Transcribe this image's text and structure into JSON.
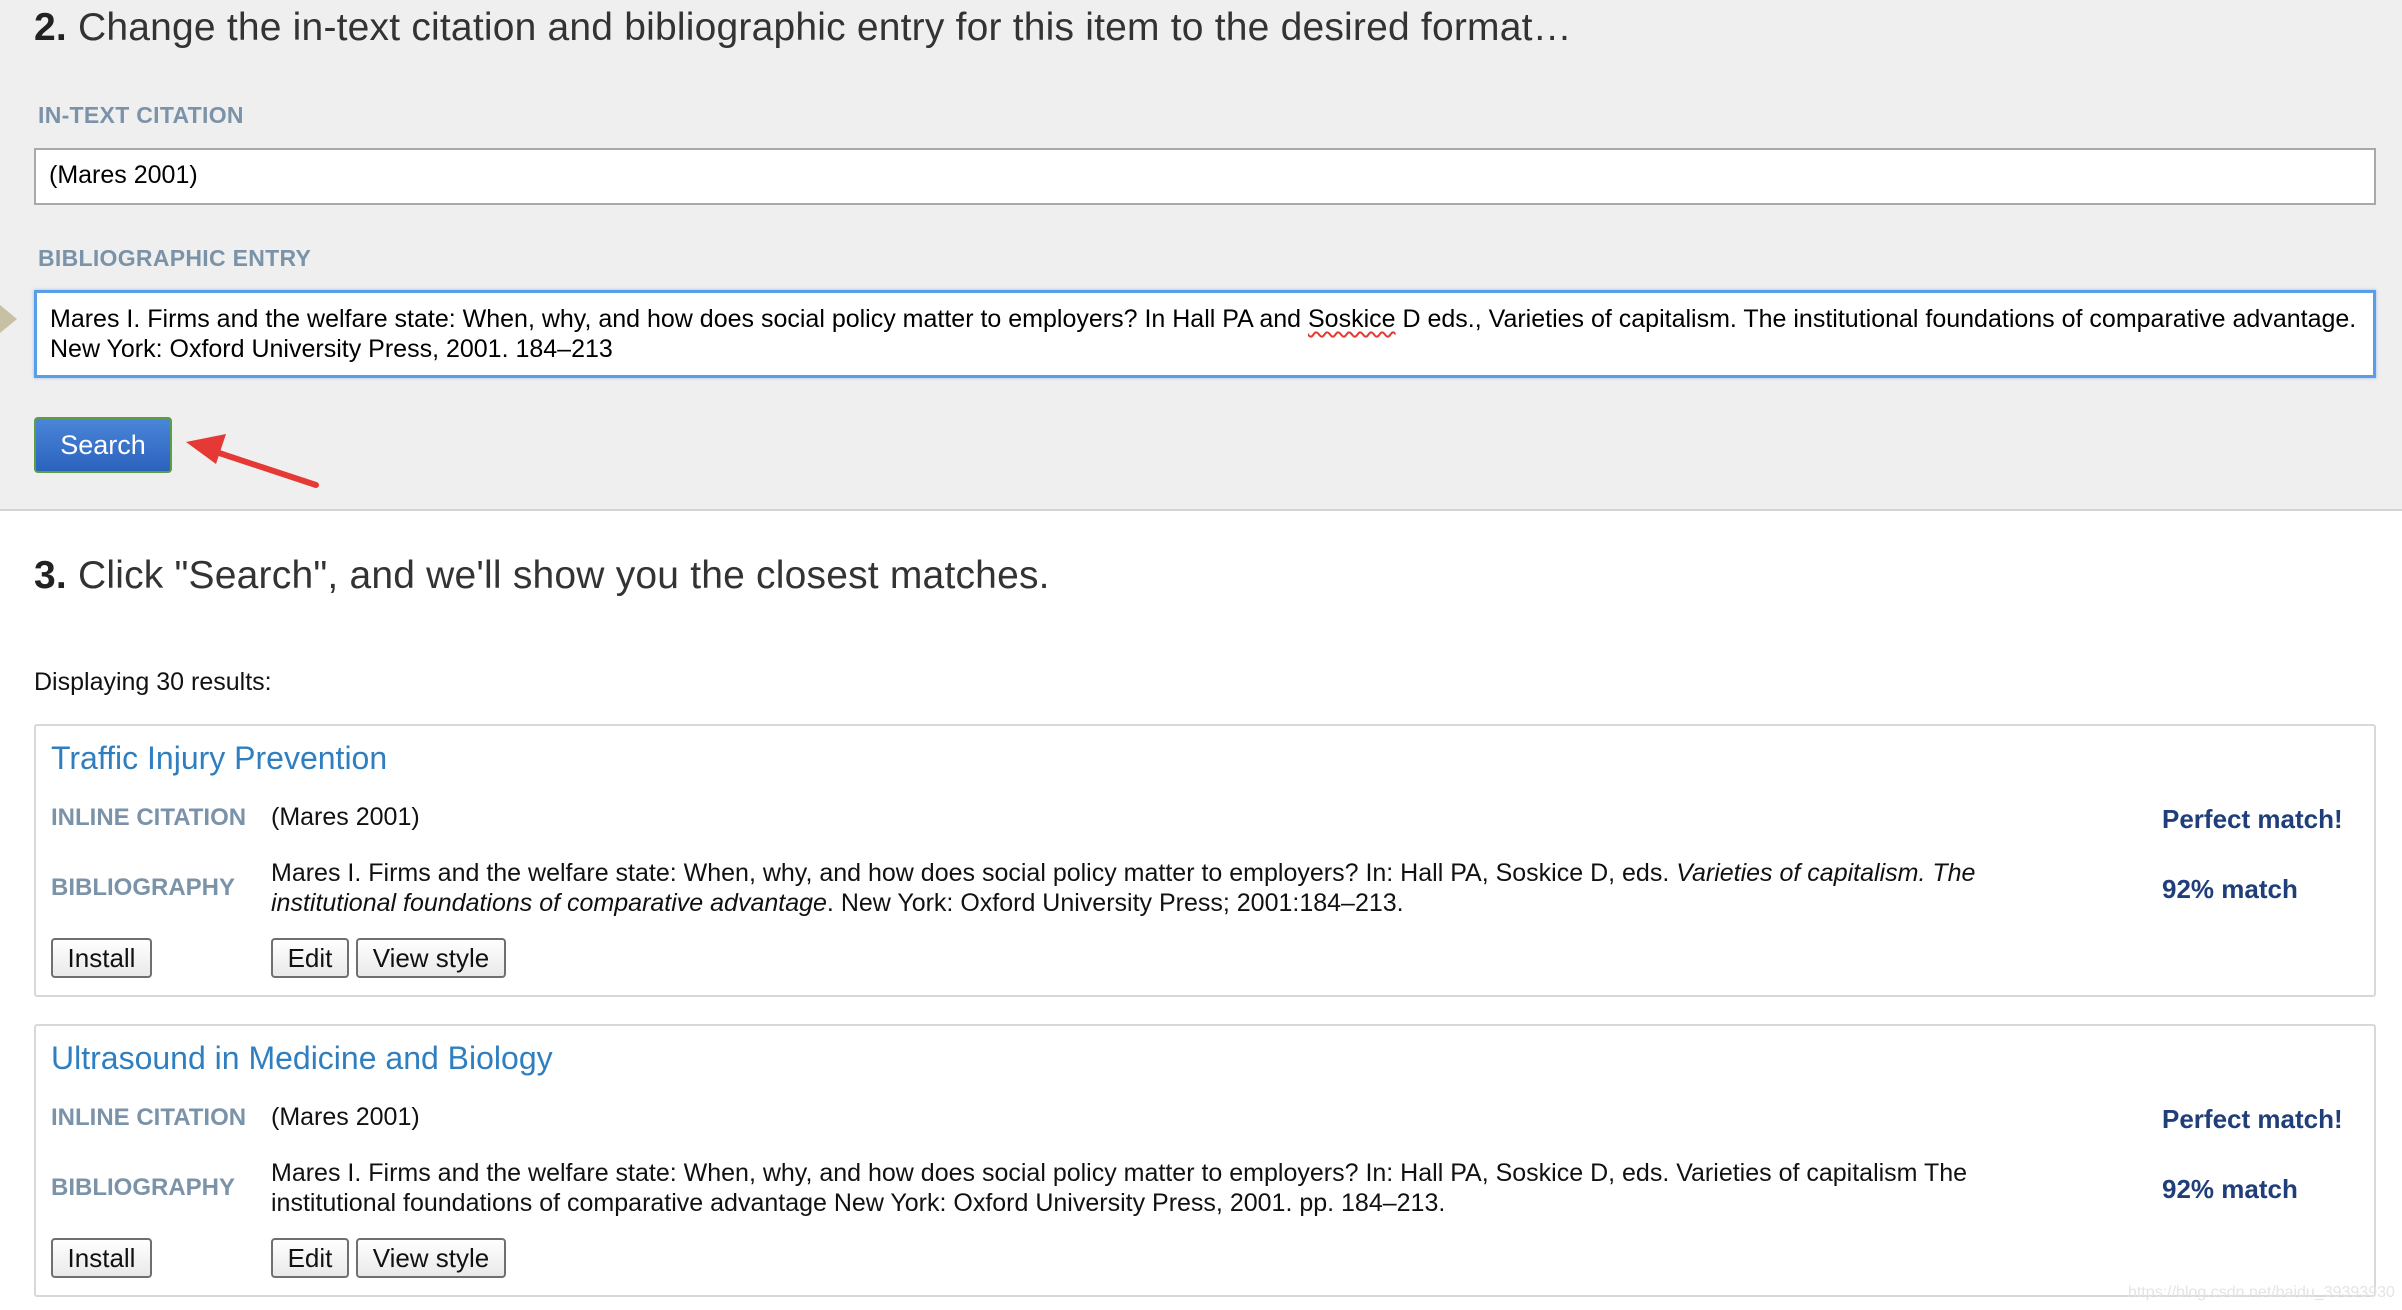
{
  "step2": {
    "number": "2.",
    "heading": "Change the in-text citation and bibliographic entry for this item to the desired format…",
    "in_text_label": "IN-TEXT CITATION",
    "in_text_value": "(Mares 2001)",
    "bib_label": "BIBLIOGRAPHIC ENTRY",
    "bib_value_before": "Mares I. Firms and the welfare state: When, why, and how does social policy matter to employers? In Hall PA and ",
    "bib_value_misspelled": "Soskice",
    "bib_value_after": " D eds., Varieties of capitalism. The institutional foundations of comparative advantage. New York: Oxford University Press, 2001. 184–213",
    "search_label": "Search"
  },
  "step3": {
    "number": "3.",
    "heading": "Click \"Search\", and we'll show you the closest matches.",
    "results_count": "Displaying 30 results:"
  },
  "labels": {
    "inline_citation": "INLINE CITATION",
    "bibliography": "BIBLIOGRAPHY",
    "install": "Install",
    "edit": "Edit",
    "view_style": "View style"
  },
  "results": [
    {
      "title": "Traffic Injury Prevention",
      "inline_citation": "(Mares 2001)",
      "inline_match": "Perfect match!",
      "bib_part1": "Mares I. Firms and the welfare state: When, why, and how does social policy matter to employers? In: Hall PA, Soskice D, eds. ",
      "bib_italic": "Varieties of capitalism. The institutional foundations of comparative advantage",
      "bib_part2": ". New York: Oxford University Press; 2001:184–213.",
      "bib_match": "92% match"
    },
    {
      "title": "Ultrasound in Medicine and Biology",
      "inline_citation": "(Mares 2001)",
      "inline_match": "Perfect match!",
      "bib_part1": "Mares I. Firms and the welfare state: When, why, and how does social policy matter to employers? In: Hall PA, Soskice D, eds. Varieties of capitalism The institutional foundations of comparative advantage New York: Oxford University Press, 2001. pp. 184–213.",
      "bib_match": "92% match"
    }
  ],
  "watermark": "https://blog.csdn.net/baidu_39393930",
  "colors": {
    "accent_blue": "#2f7fc0",
    "label_gray_blue": "#7b93a9",
    "match_navy": "#1f3e7a",
    "annotation_arrow": "#e53935"
  }
}
